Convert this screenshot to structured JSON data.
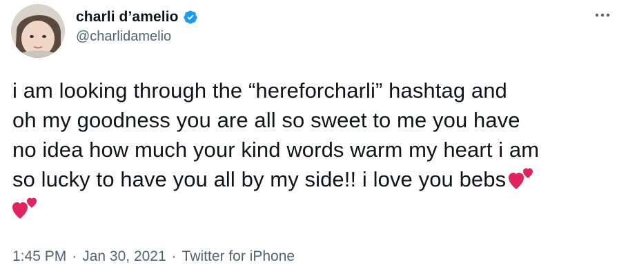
{
  "author": {
    "display_name": "charli d’amelio",
    "handle": "@charlidamelio",
    "verified_badge_icon": "verified-badge-icon",
    "verified_color": "#1d9bf0"
  },
  "tweet": {
    "lines": [
      "i am looking through the “hereforcharli” hashtag and",
      "oh my goodness you are all so sweet to me you have",
      "no idea how much your kind words warm my heart i am",
      "so lucky to have you all by my side!! i love you bebs"
    ],
    "emoji": "two-hearts-icon",
    "emoji_color": "#e0245e"
  },
  "meta": {
    "time": "1:45 PM",
    "separator": "·",
    "date": "Jan 30, 2021",
    "source": "Twitter for iPhone"
  },
  "menu": {
    "more_icon": "more-horizontal-icon"
  },
  "colors": {
    "text_primary": "#0f1419",
    "text_secondary": "#536471"
  }
}
